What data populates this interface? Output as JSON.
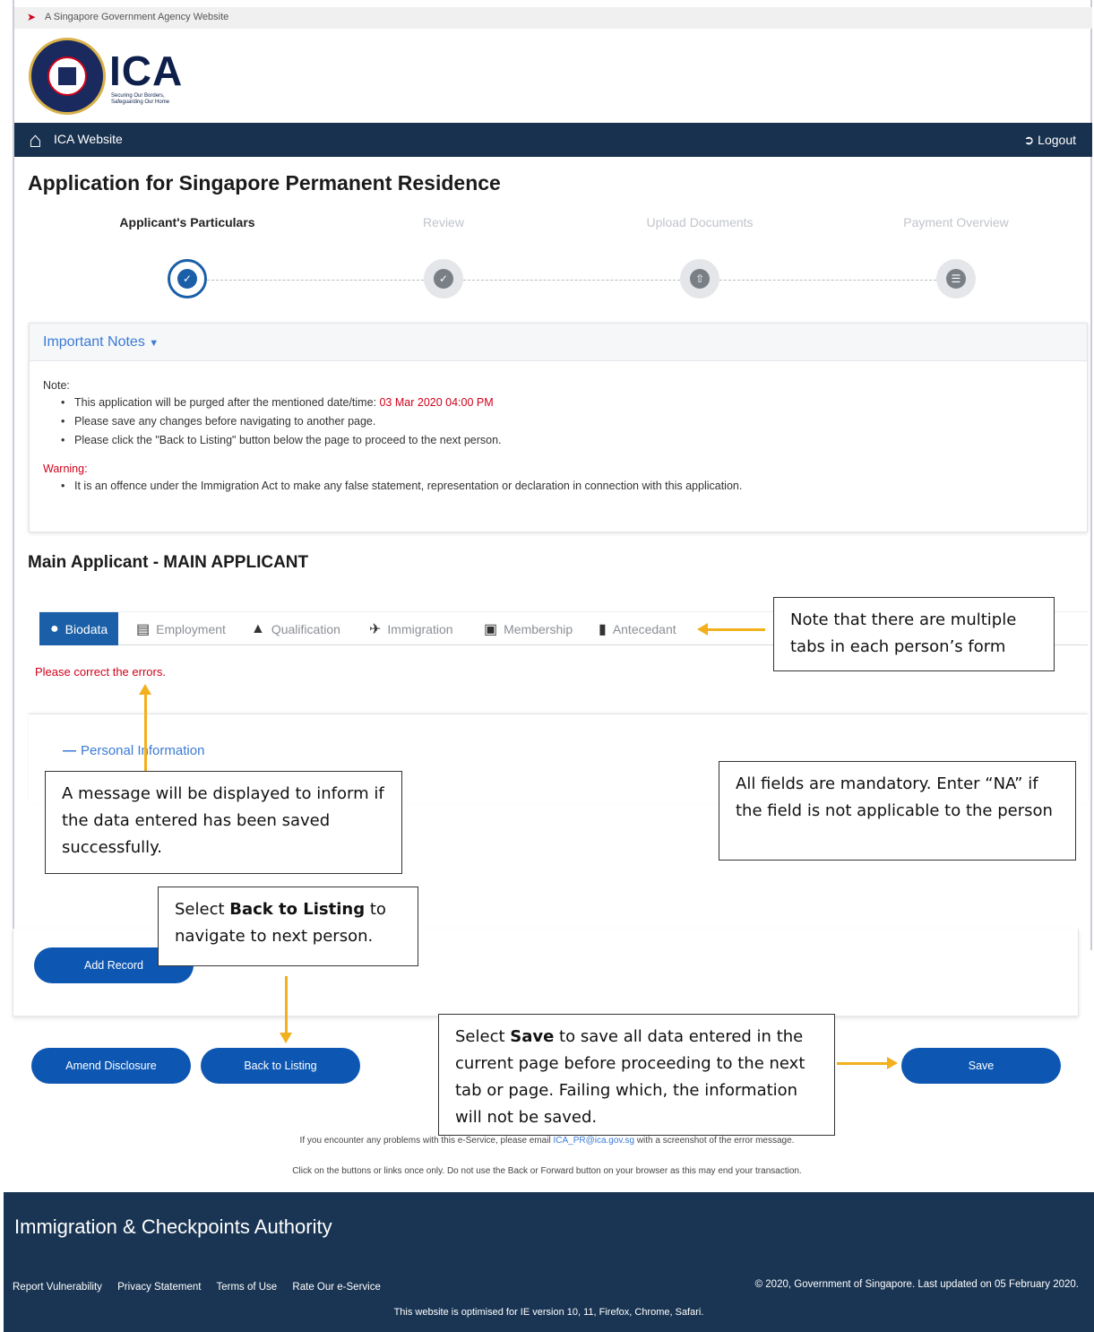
{
  "gov_banner": "A Singapore Government Agency Website",
  "logo": {
    "text": "ICA",
    "tagline": "Securing Our Borders, Safeguarding Our Home"
  },
  "nav": {
    "home_label": "ICA Website",
    "logout_label": "Logout"
  },
  "page_title": "Application for Singapore Permanent Residence",
  "steps": [
    {
      "label": "Applicant's Particulars",
      "active": true
    },
    {
      "label": "Review",
      "active": false
    },
    {
      "label": "Upload Documents",
      "active": false
    },
    {
      "label": "Payment Overview",
      "active": false
    }
  ],
  "notes": {
    "header": "Important Notes",
    "note_label": "Note:",
    "note_items": [
      "This application will be purged after the mentioned date/time: ",
      "Please save any changes before navigating to another page.",
      "Please click the \"Back to Listing\" button below the page to proceed to the next person."
    ],
    "purge_datetime": "03 Mar 2020 04:00 PM",
    "warning_label": "Warning:",
    "warning_items": [
      "It is an offence under the Immigration Act to make any false statement, representation or declaration in connection with this application."
    ]
  },
  "section_title": "Main Applicant - MAIN APPLICANT",
  "tabs": [
    {
      "label": "Biodata",
      "icon": "user-circle-icon",
      "active": true
    },
    {
      "label": "Employment",
      "icon": "briefcase-icon",
      "active": false
    },
    {
      "label": "Qualification",
      "icon": "graduation-cap-icon",
      "active": false
    },
    {
      "label": "Immigration",
      "icon": "plane-icon",
      "active": false
    },
    {
      "label": "Membership",
      "icon": "id-card-icon",
      "active": false
    },
    {
      "label": "Antecedant",
      "icon": "file-icon",
      "active": false
    }
  ],
  "error_message": "Please correct the errors.",
  "personal_info_label": "Personal Information",
  "buttons": {
    "add_record": "Add Record",
    "amend_disclosure": "Amend Disclosure",
    "back_to_listing": "Back to Listing",
    "save": "Save"
  },
  "help": {
    "line1_before": "If you encounter any problems with this e-Service, please email ",
    "email": "ICA_PR@ica.gov.sg",
    "line1_after": " with a screenshot of the error message.",
    "line2": "Click on the buttons or links once only. Do not use the Back or Forward button on your browser as this may end your transaction."
  },
  "footer": {
    "title": "Immigration & Checkpoints Authority",
    "links": [
      "Report Vulnerability",
      "Privacy Statement",
      "Terms of Use",
      "Rate Our e-Service"
    ],
    "copyright": "© 2020, Government of Singapore. Last updated on 05 February 2020.",
    "optimised": "This website is optimised for IE version 10, 11, Firefox, Chrome, Safari."
  },
  "callouts": {
    "tabs_note": "Note that there are multiple tabs in each person’s form",
    "saved_message": "A message will be displayed to inform if the data entered has been saved successfully.",
    "mandatory": "All fields are mandatory. Enter “NA” if the field is not applicable to the person",
    "back_before": "Select ",
    "back_bold": "Back to Listing",
    "back_after": " to navigate to next person.",
    "save_before": "Select ",
    "save_bold": "Save",
    "save_after": " to save all data entered in the current page before proceeding to the next tab or page. Failing which, the information will not be saved."
  },
  "colors": {
    "nav_bg": "#18314f",
    "primary_button": "#0d57b3",
    "error_red": "#d0021b",
    "link_blue": "#3a7bd5",
    "callout_arrow": "#f2b01e",
    "footer_bg": "#1a3553"
  }
}
